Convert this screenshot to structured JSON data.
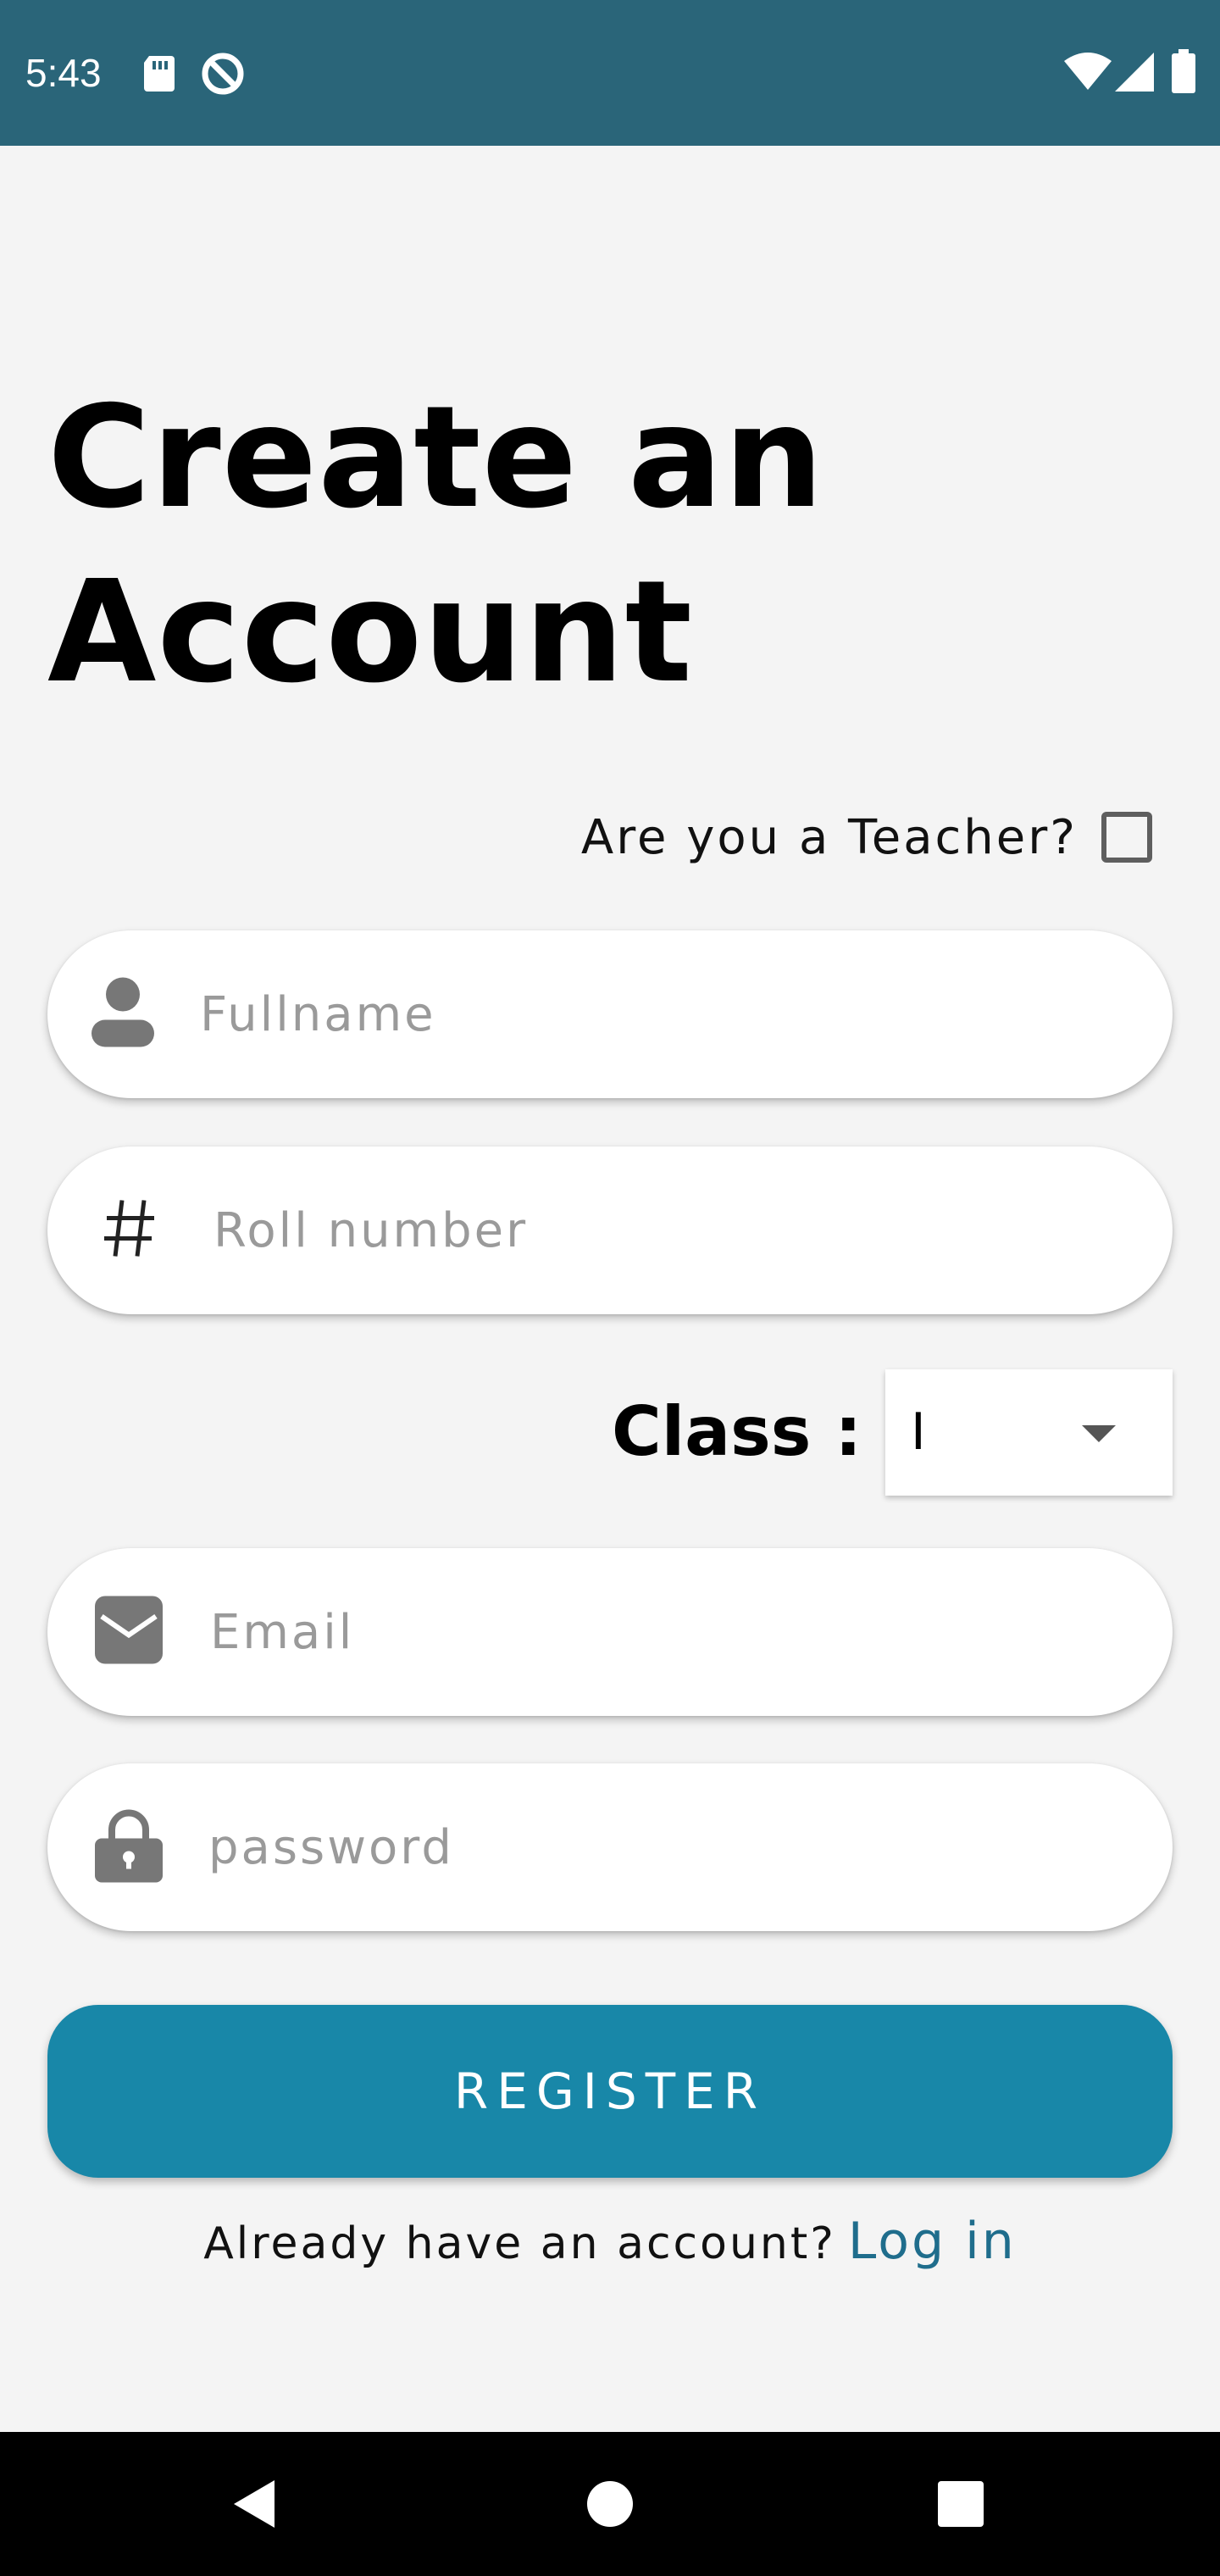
{
  "status_bar": {
    "time": "5:43",
    "left_icons": [
      "sd-card-icon",
      "data-saver-icon"
    ],
    "right_icons": [
      "wifi-icon",
      "signal-icon",
      "battery-icon"
    ],
    "background": "#2a6579"
  },
  "page": {
    "title_line1": "Create an",
    "title_line2": "Account"
  },
  "teacher": {
    "label": "Are you a Teacher?",
    "checked": false
  },
  "form": {
    "fullname": {
      "placeholder": "Fullname",
      "value": "",
      "icon": "person-icon"
    },
    "roll": {
      "placeholder": "Roll number",
      "value": "",
      "icon": "hash-icon",
      "icon_glyph": "#"
    },
    "class_label": "Class :",
    "class_value": "I",
    "email": {
      "placeholder": "Email",
      "value": "",
      "icon": "mail-icon"
    },
    "password": {
      "placeholder": "password",
      "value": "",
      "icon": "lock-icon"
    }
  },
  "register": {
    "label": "REGISTER",
    "color": "#1887a8"
  },
  "login": {
    "prompt": "Already have an account?",
    "link": "Log in",
    "link_color": "#1f6d8c"
  },
  "nav": {
    "buttons": [
      "back-icon",
      "home-icon",
      "recents-icon"
    ]
  }
}
